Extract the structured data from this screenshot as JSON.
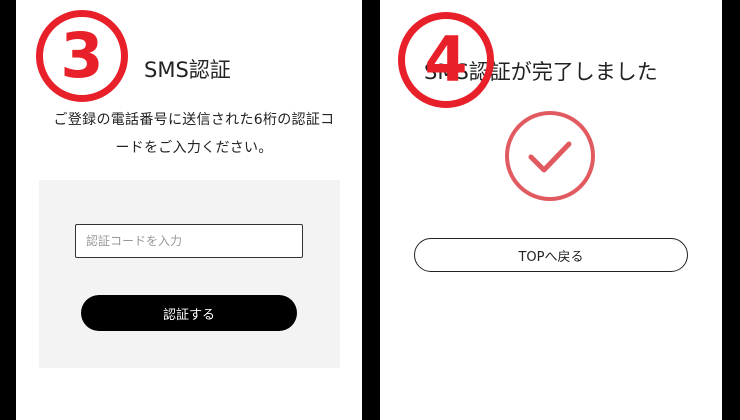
{
  "left_screen": {
    "step_number": "3",
    "title": "SMS認証",
    "instruction_line1": "ご登録の電話番号に送信された6桁の認証コ",
    "instruction_line2": "ードをご入力ください。",
    "code_input_placeholder": "認証コードを入力",
    "verify_button_label": "認証する"
  },
  "right_screen": {
    "step_number": "4",
    "title": "SMS認証が完了しました",
    "top_button_label": "TOPへ戻る"
  },
  "colors": {
    "step_marker": "#e8202a",
    "check_icon": "#e05a5f",
    "primary_button": "#000000",
    "form_background": "#f3f3f3"
  },
  "icons": [
    "check-icon"
  ]
}
